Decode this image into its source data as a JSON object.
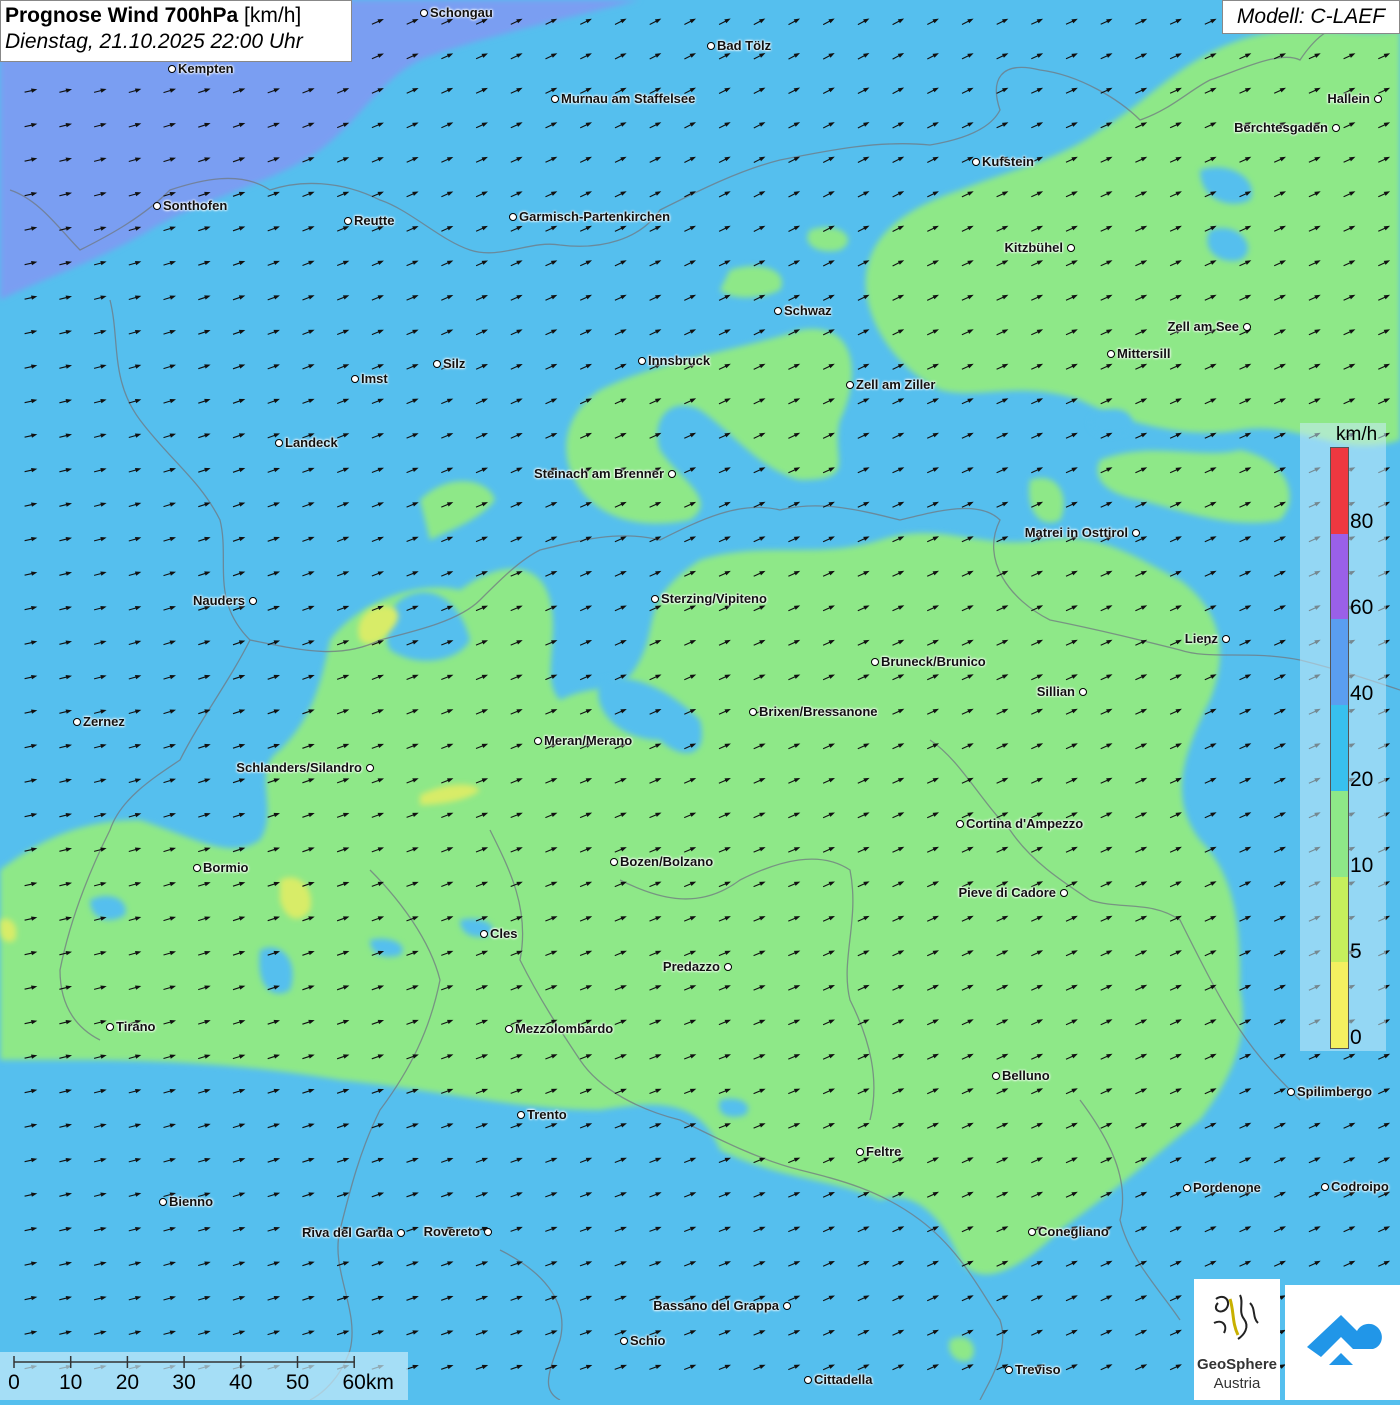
{
  "header": {
    "title_bold": "Prognose Wind 700hPa",
    "title_unit": "[km/h]",
    "datetime": "Dienstag, 21.10.2025 22:00 Uhr",
    "model": "Modell: C-LAEF"
  },
  "legend": {
    "unit": "km/h",
    "ticks": [
      "0",
      "5",
      "10",
      "20",
      "40",
      "60",
      "80"
    ],
    "colors": [
      "#f4f060",
      "#c6ef5c",
      "#8ee888",
      "#38c0ee",
      "#5a9ef0",
      "#9a60e8",
      "#ee3840"
    ]
  },
  "scale_bar": {
    "labels": [
      "0",
      "10",
      "20",
      "30",
      "40",
      "50",
      "60km"
    ]
  },
  "logos": {
    "geosphere_line1": "GeoSphere",
    "geosphere_line2": "Austria"
  },
  "background_colors": {
    "calm_green": "#8ee888",
    "moderate_blue": "#55bfee",
    "strong_blue": "#7a9ef2",
    "weak_yellow": "#d8ec68"
  },
  "cities": [
    {
      "name": "Schongau",
      "side": "right"
    },
    {
      "name": "Bad Tölz",
      "side": "right"
    },
    {
      "name": "Kempten",
      "side": "right"
    },
    {
      "name": "Murnau am Staffelsee",
      "side": "right"
    },
    {
      "name": "Hallein",
      "side": "left"
    },
    {
      "name": "Berchtesgaden",
      "side": "left"
    },
    {
      "name": "Kufstein",
      "side": "right"
    },
    {
      "name": "Sonthofen",
      "side": "right"
    },
    {
      "name": "Reutte",
      "side": "right"
    },
    {
      "name": "Garmisch-Partenkirchen",
      "side": "right"
    },
    {
      "name": "Kitzbühel",
      "side": "left"
    },
    {
      "name": "Schwaz",
      "side": "right"
    },
    {
      "name": "Zell am See",
      "side": "left"
    },
    {
      "name": "Mittersill",
      "side": "right"
    },
    {
      "name": "Innsbruck",
      "side": "right"
    },
    {
      "name": "Silz",
      "side": "right"
    },
    {
      "name": "Imst",
      "side": "right"
    },
    {
      "name": "Zell am Ziller",
      "side": "right"
    },
    {
      "name": "Landeck",
      "side": "right"
    },
    {
      "name": "Steinach am Brenner",
      "side": "left"
    },
    {
      "name": "Matrei in Osttirol",
      "side": "left"
    },
    {
      "name": "Nauders",
      "side": "left"
    },
    {
      "name": "Sterzing/Vipiteno",
      "side": "right"
    },
    {
      "name": "Lienz",
      "side": "left"
    },
    {
      "name": "Bruneck/Brunico",
      "side": "right"
    },
    {
      "name": "Sillian",
      "side": "left"
    },
    {
      "name": "Zernez",
      "side": "right"
    },
    {
      "name": "Brixen/Bressanone",
      "side": "right"
    },
    {
      "name": "Meran/Merano",
      "side": "right"
    },
    {
      "name": "Schlanders/Silandro",
      "side": "left"
    },
    {
      "name": "Cortina d'Ampezzo",
      "side": "right"
    },
    {
      "name": "Bozen/Bolzano",
      "side": "right"
    },
    {
      "name": "Bormio",
      "side": "right"
    },
    {
      "name": "Pieve di Cadore",
      "side": "left"
    },
    {
      "name": "Cles",
      "side": "right"
    },
    {
      "name": "Predazzo",
      "side": "left"
    },
    {
      "name": "Tirano",
      "side": "right"
    },
    {
      "name": "Mezzolombardo",
      "side": "right"
    },
    {
      "name": "Belluno",
      "side": "right"
    },
    {
      "name": "Spilimbergo",
      "side": "right"
    },
    {
      "name": "Trento",
      "side": "right"
    },
    {
      "name": "Feltre",
      "side": "right"
    },
    {
      "name": "Pordenone",
      "side": "right"
    },
    {
      "name": "Codroipo",
      "side": "right"
    },
    {
      "name": "Bienno",
      "side": "right"
    },
    {
      "name": "Riva del Garda",
      "side": "left"
    },
    {
      "name": "Rovereto",
      "side": "left"
    },
    {
      "name": "Conegliano",
      "side": "right"
    },
    {
      "name": "Bassano del Grappa",
      "side": "left"
    },
    {
      "name": "Schio",
      "side": "right"
    },
    {
      "name": "Treviso",
      "side": "right"
    },
    {
      "name": "Cittadella",
      "side": "right"
    }
  ]
}
